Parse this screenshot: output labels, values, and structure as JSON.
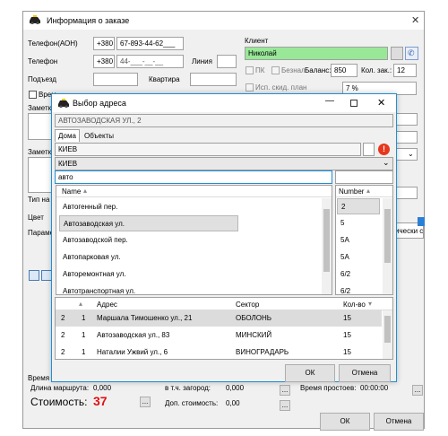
{
  "main": {
    "title": "Информация о заказе",
    "phone_aon_label": "Телефон(АОН)",
    "phone_aon_prefix": "+380",
    "phone_aon_value": "67-893-44-62___",
    "phone_label": "Телефон",
    "phone_prefix": "+380",
    "phone_value": "44-___-__-__",
    "line_label": "Линия",
    "entrance_label": "Подъезд",
    "apartment_label": "Квартира",
    "time_label": "Врем",
    "note_label_1": "Заметк",
    "note_label_2": "Заметк",
    "type_label": "Тип на",
    "color_label": "Цвет",
    "params_label": "Парамет",
    "client_label": "Клиент",
    "client_value": "Николай",
    "pk_label": "ПК",
    "cashless_label": "Безнал",
    "balance_label": "Баланс:",
    "balance_value": "850",
    "orders_count_label": "Кол. зак.:",
    "orders_count_value": "12",
    "discount_plan_label": "Исп. скид. план",
    "discount_value": "7 %",
    "right_fragment": "ически с",
    "route_time_label": "Время",
    "route_length_label": "Длина маршрута:",
    "route_length_value": "0,000",
    "suburb_label": "в т.ч. загород:",
    "suburb_value": "0,000",
    "idle_time_label": "Время простоев:",
    "idle_time_value": "00:00:00",
    "cost_label": "Стоимость:",
    "cost_value": "37",
    "extra_cost_label": "Доп. стоимость:",
    "extra_cost_value": "0,00",
    "ellipsis": "...",
    "ok_label": "ОК",
    "cancel_label": "Отмена"
  },
  "dialog": {
    "title": "Выбор адреса",
    "selected_address": "АВТОЗАВОДСКАЯ УЛ., 2",
    "tab_houses": "Дома",
    "tab_objects": "Объекты",
    "city_value": "КИЕВ",
    "city_select": "КИЕВ",
    "search_value": "авто",
    "streets_header": "Name",
    "streets": [
      "Автогенный пер.",
      "Автозаводская ул.",
      "Автозаводской пер.",
      "Автопарковая ул.",
      "Авторемонтная ул.",
      "Автотранспортная ул."
    ],
    "numbers_header": "Number",
    "numbers": [
      "2",
      "5",
      "5A",
      "5A",
      "6/2",
      "6/2"
    ],
    "history_headers": {
      "address": "Адрес",
      "sector": "Сектор",
      "count": "Кол-во"
    },
    "history_rows": [
      {
        "c1": "2",
        "c2": "1",
        "address": "Маршала Тимошенко ул., 21",
        "sector": "ОБОЛОНЬ",
        "count": "15"
      },
      {
        "c1": "2",
        "c2": "1",
        "address": "Автозаводская ул., 83",
        "sector": "МИНСКИЙ",
        "count": "15"
      },
      {
        "c1": "2",
        "c2": "1",
        "address": "Наталии Ужвий ул., 6",
        "sector": "ВИНОГРАДАРЬ",
        "count": "15"
      }
    ],
    "ok_label": "ОК",
    "cancel_label": "Отмена"
  }
}
